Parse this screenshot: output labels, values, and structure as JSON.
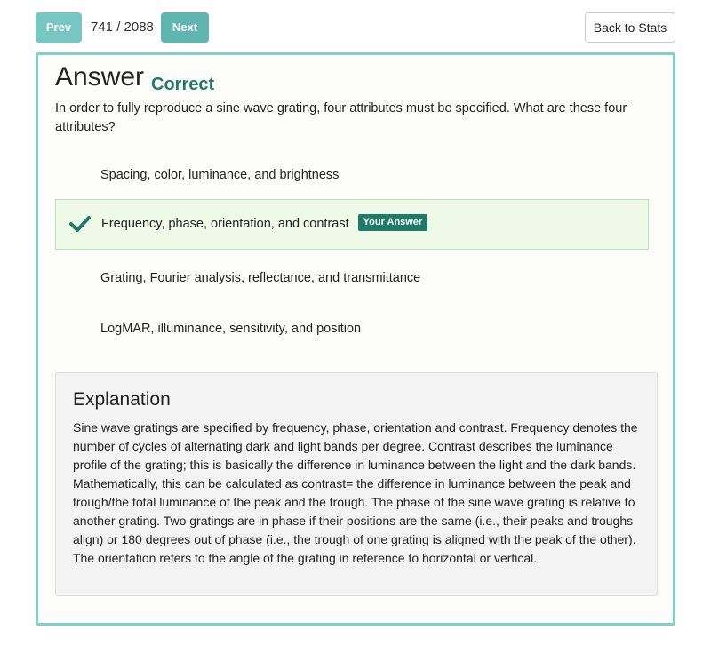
{
  "nav": {
    "prev_label": "Prev",
    "counter": "741 / 2088",
    "next_label": "Next",
    "back_label": "Back to Stats"
  },
  "answer": {
    "heading": "Answer",
    "status": "Correct",
    "question": "In order to fully reproduce a sine wave grating, four attributes must be specified. What are these four attributes?"
  },
  "options": [
    {
      "text": "Spacing, color, luminance, and brightness",
      "selected": false
    },
    {
      "text": "Frequency, phase, orientation, and contrast",
      "selected": true,
      "badge": "Your Answer",
      "icon": "checkmark-icon"
    },
    {
      "text": "Grating, Fourier analysis, reflectance, and transmittance",
      "selected": false
    },
    {
      "text": "LogMAR, illuminance, sensitivity, and position",
      "selected": false
    }
  ],
  "explanation": {
    "title": "Explanation",
    "text": "Sine wave gratings are specified by frequency, phase, orientation and contrast. Frequency denotes the number of cycles of alternating dark and light bands per degree. Contrast describes the luminance profile of the grating; this is basically the difference in luminance between the light and the dark bands. Mathematically, this can be calculated as contrast= the difference in luminance between the peak and trough/the total luminance of the peak and the trough. The phase of the sine wave grating is relative to another grating. Two gratings are in phase if their positions are the same (i.e., their peaks and troughs align) or 180 degrees out of phase (i.e., the trough of one grating is aligned with the peak of the other). The orientation refers to the angle of the grating in reference to horizontal or vertical."
  },
  "colors": {
    "accent_teal": "#68c0bc",
    "correct_green": "#1e7b6a",
    "selected_bg": "#eef9e8"
  }
}
